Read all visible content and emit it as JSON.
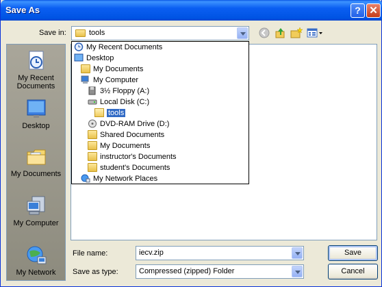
{
  "window": {
    "title": "Save As",
    "help_glyph": "?",
    "close_glyph": "✕"
  },
  "toolbar": {
    "save_in_label": "Save in:",
    "save_in_value": "tools",
    "back_icon": "back-arrow-icon",
    "up_icon": "up-folder-icon",
    "new_folder_icon": "new-folder-icon",
    "views_icon": "views-menu-icon"
  },
  "places": [
    {
      "label": "My Recent Documents",
      "line1": "My Recent",
      "line2": "Documents",
      "icon": "recent-documents-icon"
    },
    {
      "label": "Desktop",
      "line1": "Desktop",
      "line2": "",
      "icon": "desktop-icon"
    },
    {
      "label": "My Documents",
      "line1": "My Documents",
      "line2": "",
      "icon": "my-documents-icon"
    },
    {
      "label": "My Computer",
      "line1": "My Computer",
      "line2": "",
      "icon": "my-computer-icon"
    },
    {
      "label": "My Network",
      "line1": "My Network",
      "line2": "",
      "icon": "my-network-icon"
    }
  ],
  "dropdown_items": [
    {
      "label": "My Recent Documents",
      "icon": "recent-documents-icon",
      "indent": 0
    },
    {
      "label": "Desktop",
      "icon": "desktop-icon",
      "indent": 0
    },
    {
      "label": "My Documents",
      "icon": "folder-icon",
      "indent": 1
    },
    {
      "label": "My Computer",
      "icon": "computer-icon",
      "indent": 1
    },
    {
      "label": "3½ Floppy (A:)",
      "icon": "floppy-icon",
      "indent": 2
    },
    {
      "label": "Local Disk (C:)",
      "icon": "hard-disk-icon",
      "indent": 2
    },
    {
      "label": "tools",
      "icon": "open-folder-icon",
      "indent": 3,
      "selected": true
    },
    {
      "label": "DVD-RAM Drive (D:)",
      "icon": "dvd-drive-icon",
      "indent": 2
    },
    {
      "label": "Shared Documents",
      "icon": "folder-icon",
      "indent": 2
    },
    {
      "label": "My Documents",
      "icon": "folder-icon",
      "indent": 2
    },
    {
      "label": "instructor's Documents",
      "icon": "folder-icon",
      "indent": 2
    },
    {
      "label": "student's Documents",
      "icon": "folder-icon",
      "indent": 2
    },
    {
      "label": "My Network Places",
      "icon": "network-places-icon",
      "indent": 1
    }
  ],
  "form": {
    "file_name_label": "File name:",
    "file_name_value": "iecv.zip",
    "save_type_label": "Save as type:",
    "save_type_value": "Compressed (zipped) Folder"
  },
  "buttons": {
    "save": "Save",
    "cancel": "Cancel"
  },
  "colors": {
    "title_bar": "#0054e3",
    "selection": "#316ac5",
    "dialog_bg": "#ece9d8"
  }
}
